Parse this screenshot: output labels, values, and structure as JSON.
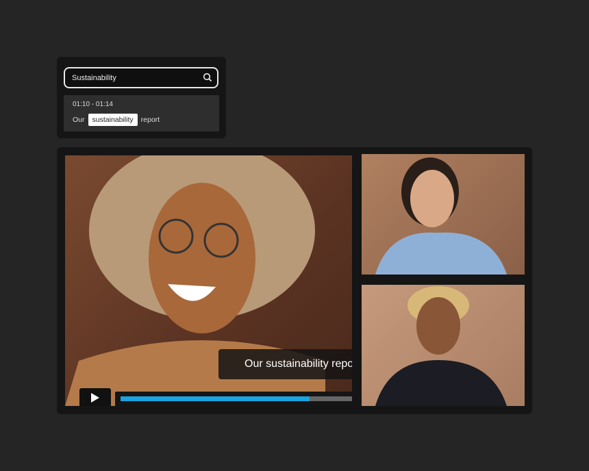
{
  "search": {
    "value": "Sustainability",
    "icon": "search-icon"
  },
  "result": {
    "time_range": "01:10 - 01:14",
    "before": "Our",
    "highlight": "sustainability",
    "after": "report"
  },
  "player": {
    "caption": "Our sustainability report",
    "progress_percent": 50,
    "accent": "#1aa3e0"
  }
}
